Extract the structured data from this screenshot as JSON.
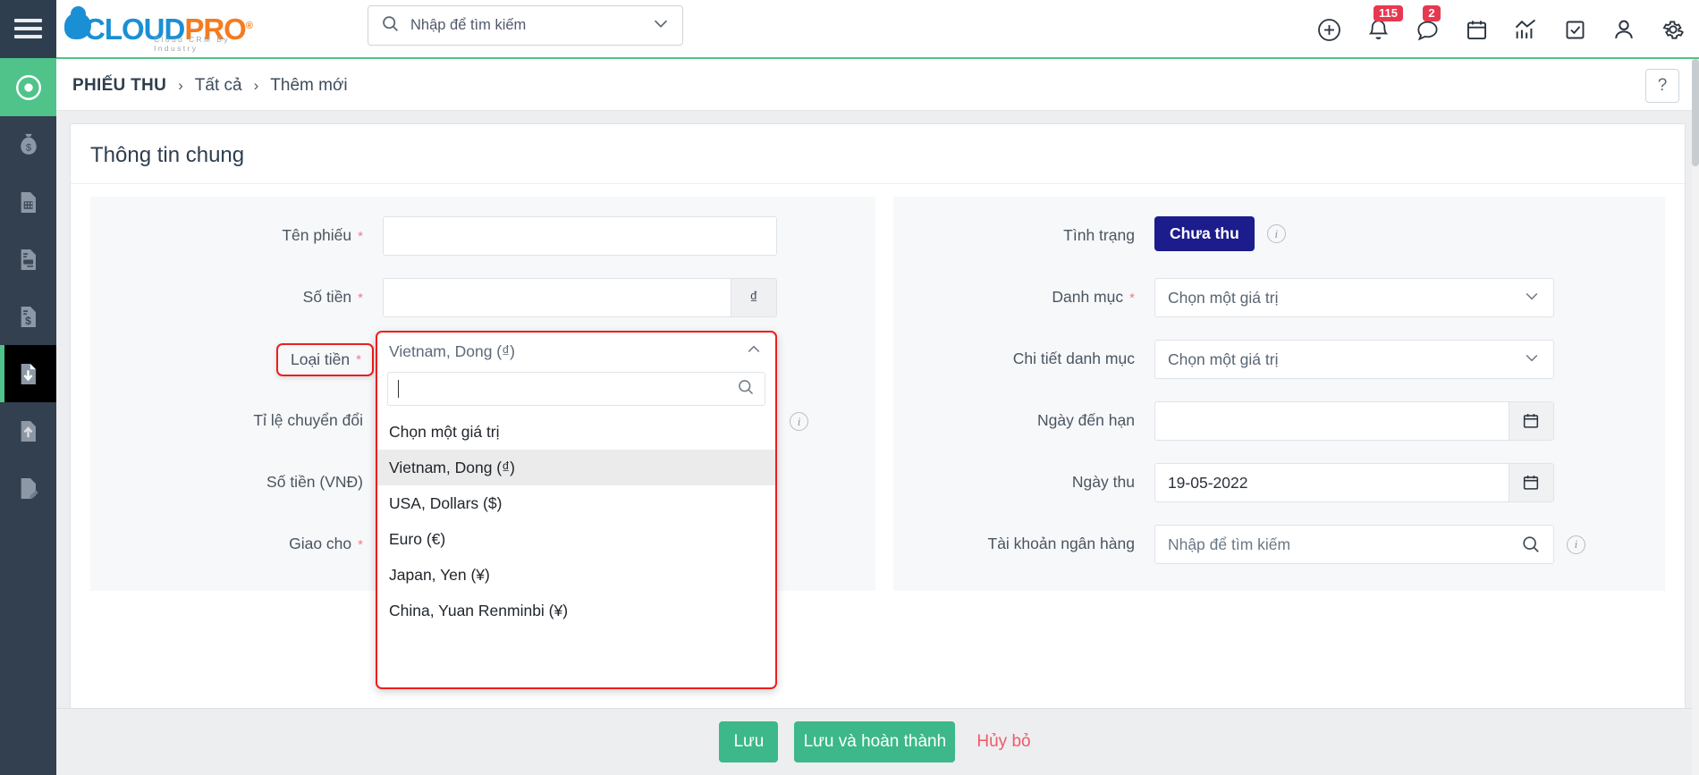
{
  "app": {
    "logo_cloud": "CLOUD",
    "logo_pro": "PRO",
    "logo_sub": "Cloud CRM By Industry",
    "logo_reg": "®",
    "accent_green": "#4fc38a",
    "accent_red": "#f01d1d",
    "brand_blue": "#1b8fd4",
    "brand_orange": "#f47b20"
  },
  "topbar": {
    "menu_icon": "hamburger-icon",
    "search": {
      "placeholder": "Nhập để tìm kiếm",
      "value": "",
      "icon": "search-icon",
      "caret_icon": "chevron-down-icon"
    },
    "icons": [
      {
        "name": "add-circle-icon",
        "badge": ""
      },
      {
        "name": "bell-icon",
        "badge": "115"
      },
      {
        "name": "chat-icon",
        "badge": "2"
      },
      {
        "name": "calendar-icon",
        "badge": ""
      },
      {
        "name": "analytics-icon",
        "badge": ""
      },
      {
        "name": "checkbox-task-icon",
        "badge": ""
      },
      {
        "name": "user-icon",
        "badge": ""
      },
      {
        "name": "gear-icon",
        "badge": ""
      }
    ]
  },
  "rail": {
    "items": [
      {
        "name": "target-icon",
        "state": "active-green"
      },
      {
        "name": "money-bag-icon",
        "state": ""
      },
      {
        "name": "invoice-grid-icon",
        "state": ""
      },
      {
        "name": "document-card-icon",
        "state": ""
      },
      {
        "name": "document-money-icon",
        "state": ""
      },
      {
        "name": "receipt-in-icon",
        "state": "active-dark"
      },
      {
        "name": "receipt-out-icon",
        "state": ""
      },
      {
        "name": "document-edit-icon",
        "state": ""
      }
    ]
  },
  "breadcrumb": {
    "items": [
      "PHIẾU THU",
      "Tất cả",
      "Thêm mới"
    ],
    "separator": "›",
    "help_label": "?"
  },
  "card": {
    "title": "Thông tin chung"
  },
  "left_form": {
    "fields": [
      {
        "label": "Tên phiếu",
        "required": true,
        "type": "text",
        "value": ""
      },
      {
        "label": "Số tiền",
        "required": true,
        "type": "currency",
        "value": "",
        "suffix": "₫"
      },
      {
        "label": "Loại tiền",
        "required": true,
        "type": "select-open",
        "value": "Vietnam, Dong (₫)"
      },
      {
        "label": "Tỉ lệ chuyển đổi",
        "required": false,
        "type": "text",
        "value": ""
      },
      {
        "label": "Số tiền (VNĐ)",
        "required": false,
        "type": "text",
        "value": ""
      },
      {
        "label": "Giao cho",
        "required": true,
        "type": "text",
        "value": ""
      }
    ]
  },
  "currency_dropdown": {
    "selected_display": "Vietnam, Dong (₫)",
    "search_value": "",
    "collapse_icon": "chevron-up-icon",
    "search_icon": "search-icon",
    "options": [
      {
        "label": "Chọn một giá trị",
        "selected": false
      },
      {
        "label": "Vietnam, Dong (₫)",
        "selected": true
      },
      {
        "label": "USA, Dollars ($)",
        "selected": false
      },
      {
        "label": "Euro (€)",
        "selected": false
      },
      {
        "label": "Japan, Yen (¥)",
        "selected": false
      },
      {
        "label": "China, Yuan Renminbi (¥)",
        "selected": false
      }
    ]
  },
  "right_form": {
    "status": {
      "label": "Tình trạng",
      "value": "Chưa thu",
      "info_icon": "info-icon"
    },
    "category": {
      "label": "Danh mục",
      "required": true,
      "placeholder": "Chọn một giá trị",
      "chevron": "chevron-down-icon"
    },
    "category_detail": {
      "label": "Chi tiết danh mục",
      "required": false,
      "placeholder": "Chọn một giá trị",
      "chevron": "chevron-down-icon"
    },
    "due_date": {
      "label": "Ngày đến hạn",
      "value": "",
      "icon": "calendar-icon"
    },
    "collect_date": {
      "label": "Ngày thu",
      "value": "19-05-2022",
      "icon": "calendar-icon"
    },
    "bank_account": {
      "label": "Tài khoản ngân hàng",
      "placeholder": "Nhập để tìm kiếm",
      "icon": "search-icon",
      "info_icon": "info-icon"
    }
  },
  "footer": {
    "save_label": "Lưu",
    "save_complete_label": "Lưu và hoàn thành",
    "cancel_label": "Hủy bỏ"
  }
}
